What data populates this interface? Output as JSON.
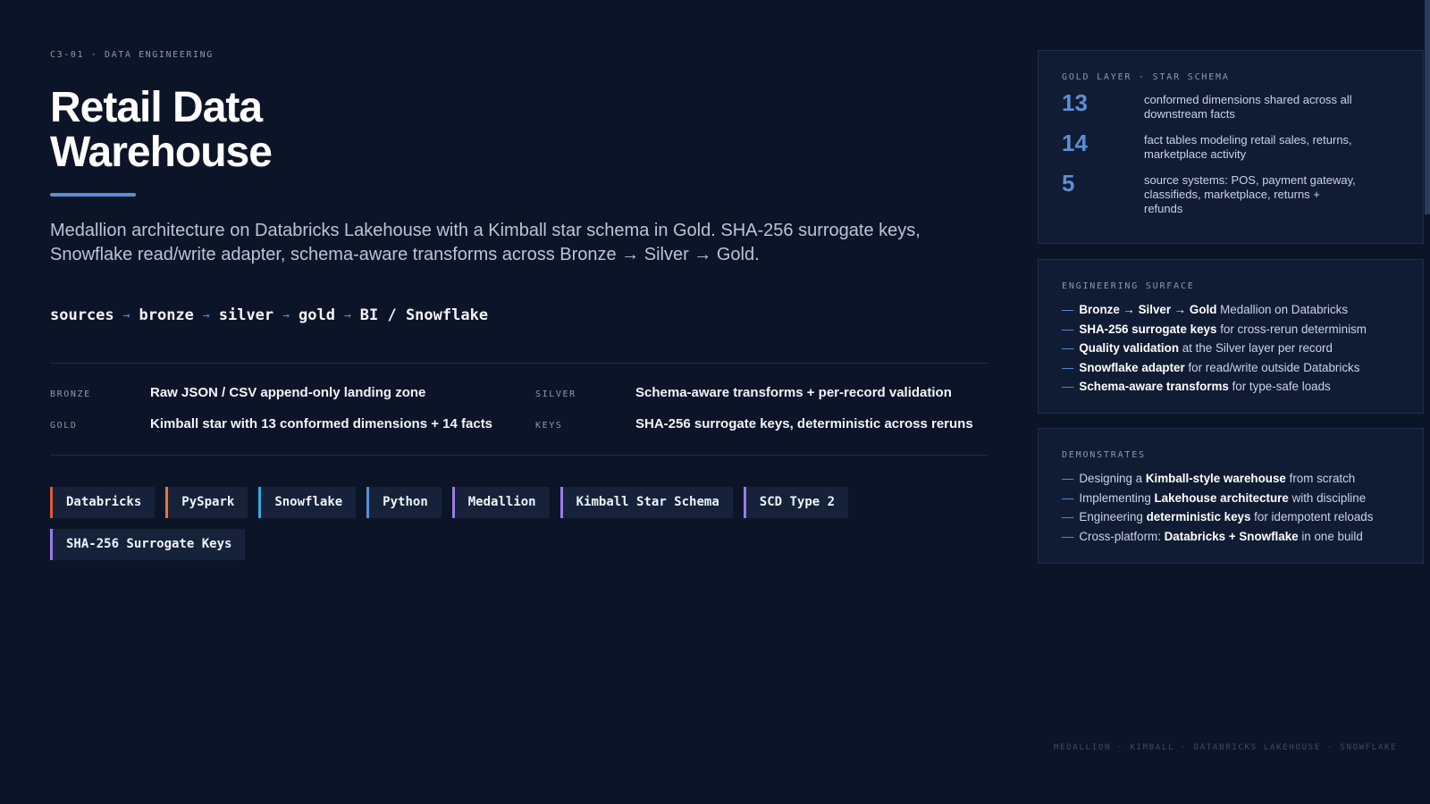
{
  "eyebrow": "C3-01 · DATA ENGINEERING",
  "title": "Retail Data Warehouse",
  "lede": "Medallion architecture on Databricks Lakehouse with a Kimball star schema in Gold. SHA-256 surrogate keys, Snowflake read/write adapter, schema-aware transforms across Bronze → Silver → Gold.",
  "flow": {
    "steps": [
      "sources",
      "bronze",
      "silver",
      "gold",
      "BI / Snowflake"
    ],
    "arrow": "→"
  },
  "specs": [
    {
      "key": "BRONZE",
      "value": "Raw JSON / CSV append-only landing zone"
    },
    {
      "key": "SILVER",
      "value": "Schema-aware transforms + per-record validation"
    },
    {
      "key": "GOLD",
      "value": "Kimball star with 13 conformed dimensions + 14 facts"
    },
    {
      "key": "KEYS",
      "value": "SHA-256 surrogate keys, deterministic across reruns"
    }
  ],
  "tags": [
    {
      "label": "Databricks",
      "color": "#e0573b"
    },
    {
      "label": "PySpark",
      "color": "#e07a3b"
    },
    {
      "label": "Snowflake",
      "color": "#3ba7e0"
    },
    {
      "label": "Python",
      "color": "#5b8fd6"
    },
    {
      "label": "Medallion",
      "color": "#9b7be8"
    },
    {
      "label": "Kimball Star Schema",
      "color": "#9b7be8"
    },
    {
      "label": "SCD Type 2",
      "color": "#9b7be8"
    },
    {
      "label": "SHA-256 Surrogate Keys",
      "color": "#9b7be8"
    }
  ],
  "gold_card": {
    "title": "GOLD LAYER · STAR SCHEMA",
    "stats": [
      {
        "num": "13",
        "desc": "conformed dimensions shared across all downstream facts"
      },
      {
        "num": "14",
        "desc": "fact tables modeling retail sales, returns, marketplace activity"
      },
      {
        "num": "5",
        "desc": "source systems: POS, payment gateway, classifieds, marketplace, returns + refunds"
      }
    ]
  },
  "eng_card": {
    "title": "ENGINEERING SURFACE",
    "items": [
      {
        "bold": "Bronze → Silver → Gold",
        "rest": " Medallion on Databricks"
      },
      {
        "bold": "SHA-256 surrogate keys",
        "rest": " for cross-rerun determinism"
      },
      {
        "bold": "Quality validation",
        "rest": " at the Silver layer per record"
      },
      {
        "bold": "Snowflake adapter",
        "rest": " for read/write outside Databricks"
      },
      {
        "bold": "Schema-aware transforms",
        "rest": " for type-safe loads"
      }
    ]
  },
  "demo_card": {
    "title": "DEMONSTRATES",
    "items": [
      {
        "pre": "Designing a ",
        "bold": "Kimball-style warehouse",
        "rest": " from scratch"
      },
      {
        "pre": "Implementing ",
        "bold": "Lakehouse architecture",
        "rest": " with discipline"
      },
      {
        "pre": "Engineering ",
        "bold": "deterministic keys",
        "rest": " for idempotent reloads"
      },
      {
        "pre": "Cross-platform: ",
        "bold": "Databricks + Snowflake",
        "rest": " in one build"
      }
    ]
  },
  "footer": "MEDALLION · KIMBALL · DATABRICKS LAKEHOUSE · SNOWFLAKE",
  "accent": "#5b8fd6",
  "background": "#0c1528"
}
